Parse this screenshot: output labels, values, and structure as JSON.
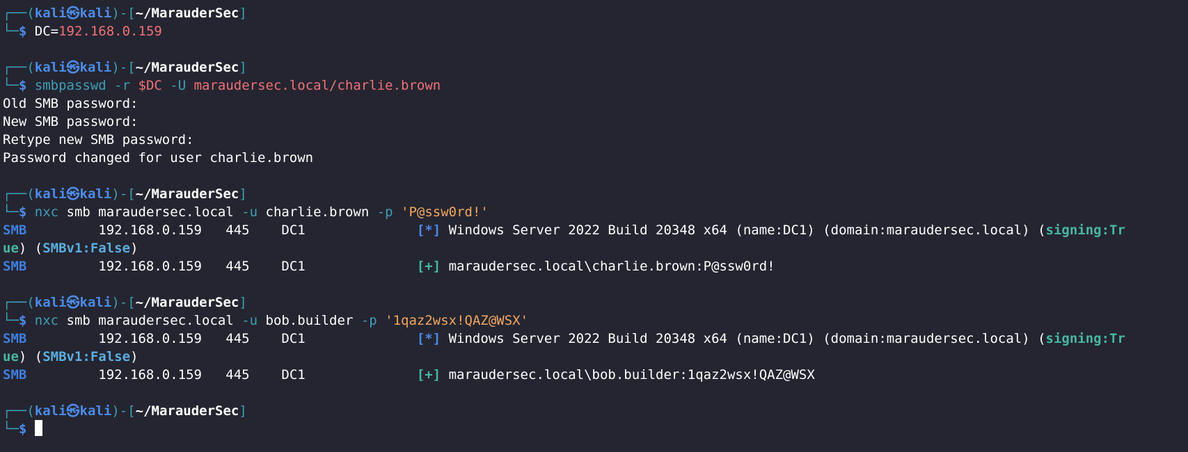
{
  "terminal": {
    "user": "kali",
    "at": "㉿",
    "host": "kali",
    "cwd": "~/MarauderSec",
    "prompt_symbol": "$",
    "frame_top": "┌──(",
    "frame_mid": ")-[",
    "frame_end": "]",
    "frame_bottom": "└─",
    "blocks": [
      {
        "cmd_parts": [
          {
            "text": " DC=",
            "cls": "c-arg"
          },
          {
            "text": "192.168.0.159",
            "cls": "c-red"
          }
        ],
        "output": []
      },
      {
        "cmd_parts": [
          {
            "text": " smbpasswd",
            "cls": "c-cmd"
          },
          {
            "text": " -r ",
            "cls": "c-cmd"
          },
          {
            "text": "$DC",
            "cls": "c-red"
          },
          {
            "text": " -U ",
            "cls": "c-cmd"
          },
          {
            "text": "maraudersec.local/charlie.brown",
            "cls": "c-red"
          }
        ],
        "output": [
          [
            {
              "text": "Old SMB password:",
              "cls": "c-out"
            }
          ],
          [
            {
              "text": "New SMB password:",
              "cls": "c-out"
            }
          ],
          [
            {
              "text": "Retype new SMB password:",
              "cls": "c-out"
            }
          ],
          [
            {
              "text": "Password changed for user charlie.brown",
              "cls": "c-out"
            }
          ]
        ]
      },
      {
        "cmd_parts": [
          {
            "text": " nxc",
            "cls": "c-cmd"
          },
          {
            "text": " smb maraudersec.local ",
            "cls": "c-arg"
          },
          {
            "text": "-u",
            "cls": "c-cmd"
          },
          {
            "text": " charlie.brown ",
            "cls": "c-arg"
          },
          {
            "text": "-p",
            "cls": "c-cmd"
          },
          {
            "text": " 'P@ssw0rd!'",
            "cls": "c-str"
          }
        ],
        "output": [
          [
            {
              "text": "SMB",
              "cls": "c-smb"
            },
            {
              "text": "         192.168.0.159   445    DC1              ",
              "cls": "c-out"
            },
            {
              "text": "[*]",
              "cls": "c-info"
            },
            {
              "text": " Windows Server 2022 Build 20348 x64 (name:DC1) (domain:maraudersec.local) (",
              "cls": "c-out"
            },
            {
              "text": "signing:Tr",
              "cls": "c-sign"
            }
          ],
          [
            {
              "text": "ue",
              "cls": "c-sign"
            },
            {
              "text": ") (",
              "cls": "c-out"
            },
            {
              "text": "SMBv1:False",
              "cls": "c-smbv1"
            },
            {
              "text": ")",
              "cls": "c-out"
            }
          ],
          [
            {
              "text": "SMB",
              "cls": "c-smb"
            },
            {
              "text": "         192.168.0.159   445    DC1              ",
              "cls": "c-out"
            },
            {
              "text": "[+]",
              "cls": "c-ok"
            },
            {
              "text": " maraudersec.local\\charlie.brown:P@ssw0rd!",
              "cls": "c-out"
            }
          ]
        ]
      },
      {
        "cmd_parts": [
          {
            "text": " nxc",
            "cls": "c-cmd"
          },
          {
            "text": " smb maraudersec.local ",
            "cls": "c-arg"
          },
          {
            "text": "-u",
            "cls": "c-cmd"
          },
          {
            "text": " bob.builder ",
            "cls": "c-arg"
          },
          {
            "text": "-p",
            "cls": "c-cmd"
          },
          {
            "text": " '1qaz2wsx!QAZ@WSX'",
            "cls": "c-str"
          }
        ],
        "output": [
          [
            {
              "text": "SMB",
              "cls": "c-smb"
            },
            {
              "text": "         192.168.0.159   445    DC1              ",
              "cls": "c-out"
            },
            {
              "text": "[*]",
              "cls": "c-info"
            },
            {
              "text": " Windows Server 2022 Build 20348 x64 (name:DC1) (domain:maraudersec.local) (",
              "cls": "c-out"
            },
            {
              "text": "signing:Tr",
              "cls": "c-sign"
            }
          ],
          [
            {
              "text": "ue",
              "cls": "c-sign"
            },
            {
              "text": ") (",
              "cls": "c-out"
            },
            {
              "text": "SMBv1:False",
              "cls": "c-smbv1"
            },
            {
              "text": ")",
              "cls": "c-out"
            }
          ],
          [
            {
              "text": "SMB",
              "cls": "c-smb"
            },
            {
              "text": "         192.168.0.159   445    DC1              ",
              "cls": "c-out"
            },
            {
              "text": "[+]",
              "cls": "c-ok"
            },
            {
              "text": " maraudersec.local\\bob.builder:1qaz2wsx!QAZ@WSX",
              "cls": "c-out"
            }
          ]
        ]
      },
      {
        "cmd_parts": [
          {
            "text": " ",
            "cls": "c-arg"
          }
        ],
        "output": [],
        "cursor": true
      }
    ],
    "colors": {
      "background": "#242530",
      "frame": "#3f9fb7",
      "user": "#4c8be8",
      "red": "#f07178",
      "string": "#f3a75e",
      "ok": "#47b7a3"
    }
  }
}
